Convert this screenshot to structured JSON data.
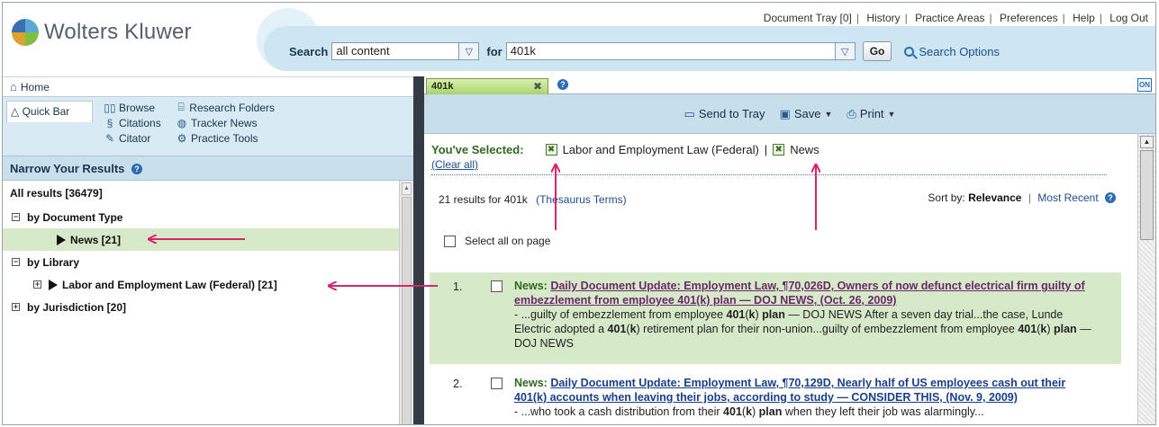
{
  "brand": {
    "name": "Wolters Kluwer"
  },
  "top_links": [
    "Document Tray [0]",
    "History",
    "Practice Areas",
    "Preferences",
    "Help",
    "Log Out"
  ],
  "search": {
    "label": "Search",
    "scope_value": "all content",
    "for_label": "for",
    "query_value": "401k",
    "go_label": "Go",
    "options_label": "Search Options"
  },
  "nav": {
    "home_label": "Home"
  },
  "quickbar": {
    "tab_label": "Quick Bar",
    "items": [
      {
        "label": "Browse",
        "icon": "book-icon"
      },
      {
        "label": "Research Folders",
        "icon": "folder-icon"
      },
      {
        "label": "Citations",
        "icon": "citations-icon"
      },
      {
        "label": "Tracker News",
        "icon": "globe-icon"
      },
      {
        "label": "Citator",
        "icon": "citator-icon"
      },
      {
        "label": "Practice Tools",
        "icon": "gear-icon"
      }
    ]
  },
  "narrow": {
    "header": "Narrow Your Results",
    "all_results": "All results [36479]",
    "tree": [
      {
        "label": "by Document Type",
        "level": 0,
        "expanded": true
      },
      {
        "label": "News [21]",
        "level": 1,
        "highlighted": true
      },
      {
        "label": "by Library",
        "level": 0,
        "expanded": true
      },
      {
        "label": "Labor and Employment Law (Federal) [21]",
        "level": 1
      },
      {
        "label": "by Jurisdiction [20]",
        "level": 0,
        "expanded": false
      }
    ]
  },
  "doc_tab": {
    "label": "401k",
    "on_label": "ON"
  },
  "toolbar": {
    "send_to_tray": "Send to Tray",
    "save": "Save",
    "print": "Print"
  },
  "selection": {
    "label": "You've Selected:",
    "filters": [
      "Labor and Employment Law (Federal)",
      "News"
    ],
    "separator": "|",
    "clear_all": "(Clear all)"
  },
  "results_summary": {
    "prefix": "21 results for",
    "query": "401k",
    "thesaurus": "(Thesaurus Terms)",
    "sort_label": "Sort by:",
    "sort_active": "Relevance",
    "sort_other": "Most Recent"
  },
  "select_all_label": "Select all on page",
  "results": [
    {
      "number": "1.",
      "type": "News:",
      "title": "Daily Document Update: Employment Law, ¶70,026D, Owners of now defunct electrical firm guilty of embezzlement from employee 401(k) plan — DOJ NEWS, (Oct. 26, 2009)",
      "snippet_parts": [
        " - ...guilty of embezzlement from employee ",
        "401",
        "(",
        "k",
        ") ",
        "plan",
        " — DOJ NEWS After a seven day trial...the case, Lunde Electric adopted a ",
        "401",
        "(",
        "k",
        ") retirement plan for their non-union...guilty of embezzlement from employee ",
        "401",
        "(",
        "k",
        ") ",
        "plan",
        " — DOJ NEWS"
      ]
    },
    {
      "number": "2.",
      "type": "News:",
      "title": "Daily Document Update: Employment Law, ¶70,129D, Nearly half of US employees cash out their 401(k) accounts when leaving their jobs, according to study — CONSIDER THIS, (Nov. 9, 2009)",
      "snippet_parts": [
        " - ...who took a cash distribution from their ",
        "401",
        "(",
        "k",
        ") ",
        "plan",
        " when they left their job was alarmingly..."
      ]
    }
  ],
  "colors": {
    "highlight_green": "#d6e9c8",
    "toolbar_blue": "#c6dfea",
    "annotation_arrow": "#d8246a",
    "link_blue": "#1a4f8f",
    "selected_green": "#2e6a1e"
  }
}
